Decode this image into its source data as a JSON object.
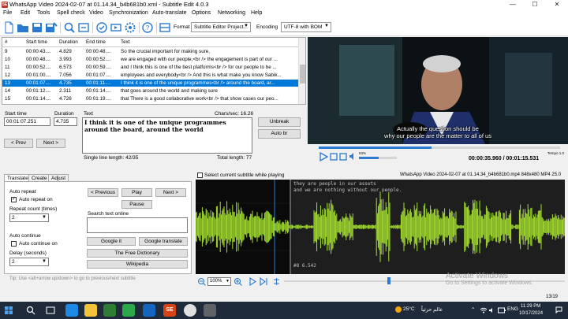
{
  "window": {
    "title": "WhatsApp Video 2024-02-07 at 01.14.34_b4b681b0.xml - Subtitle Edit 4.0.3",
    "app_icon": "subtitle-edit-icon"
  },
  "menu": [
    "File",
    "Edit",
    "Tools",
    "Spell check",
    "Video",
    "Synchronization",
    "Auto-translate",
    "Options",
    "Networking",
    "Help"
  ],
  "toolbar": {
    "format_label": "Format",
    "format_value": "Subtitle Editor Project...",
    "encoding_label": "Encoding",
    "encoding_value": "UTF-8 with BOM"
  },
  "grid": {
    "columns": [
      "#",
      "Start time",
      "Duration",
      "End time",
      "Text"
    ],
    "rows": [
      {
        "num": "9",
        "start": "00:00:43....",
        "duration": "4.829",
        "end": "00:00:48....",
        "text": "So the crucial important for making sure,"
      },
      {
        "num": "10",
        "start": "00:00:48....",
        "duration": "3.993",
        "end": "00:00:52....",
        "text": "we are engaged with our people,<br /> the engagement is part of our ..."
      },
      {
        "num": "11",
        "start": "00:00:52....",
        "duration": "6.573",
        "end": "00:00:59....",
        "text": "and I think this is one of the best platforms<br /> for our people to be ..."
      },
      {
        "num": "12",
        "start": "00:01:00....",
        "duration": "7.056",
        "end": "00:01:07....",
        "text": "employees and everybody<br /> And this is what make you know Sabik..."
      },
      {
        "num": "13",
        "start": "00:01:07....",
        "duration": "4.735",
        "end": "00:01:11....",
        "text": "I think it is one of the unique programmes<br /> around the board, ar..."
      },
      {
        "num": "14",
        "start": "00:01:12....",
        "duration": "2.311",
        "end": "00:01:14....",
        "text": "that goes around the world and making sure"
      },
      {
        "num": "15",
        "start": "00:01:14....",
        "duration": "4.726",
        "end": "00:01:19....",
        "text": "that There is a good collaborative work<br /> that show cases our peo..."
      }
    ],
    "selected_index": 4
  },
  "editor": {
    "start_time_label": "Start time",
    "start_time_value": "00:01:07.251",
    "duration_label": "Duration",
    "duration_value": "4.735",
    "text_label": "Text",
    "chars_sec": "Chars/sec: 16.26",
    "text_line1": "I think it is one of the unique programmes",
    "text_line2": "around the board, around the world",
    "single_line_length": "Single line length: 42/35",
    "total_length": "Total length: 77",
    "unbreak_label": "Unbreak",
    "auto_br_label": "Auto br",
    "prev_label": "< Prev",
    "next_label": "Next >"
  },
  "video": {
    "subtitle_line1": "Actually the question should be",
    "subtitle_line2": "why our people are the matter to all of us",
    "volume_pct": "53%",
    "speed": "Tempo 1.0",
    "time_current": "00:00:35.960",
    "time_total": "00:01:15.531",
    "time_separator": " / "
  },
  "tabs": [
    "Translate",
    "Create",
    "Adjust"
  ],
  "translate": {
    "auto_repeat_label": "Auto repeat",
    "auto_repeat_on_label": "Auto repeat on",
    "repeat_count_label": "Repeat count (times)",
    "repeat_count_value": "2",
    "auto_continue_label": "Auto continue",
    "auto_continue_on_label": "Auto continue on",
    "delay_label": "Delay (seconds)",
    "delay_value": "2",
    "previous_label": "< Previous",
    "play_label": "Play",
    "next_label": "Next >",
    "pause_label": "Pause",
    "search_label": "Search text online",
    "google_it_label": "Google it",
    "google_translate_label": "Google translate",
    "free_dictionary_label": "The Free Dictionary",
    "wikipedia_label": "Wikipedia",
    "tip": "Tip: Use <alt+arrow up/down> to go to previous/next subtitle"
  },
  "waveform": {
    "select_current_label": "Select current subtitle while playing",
    "file_info": "WhatsApp Video 2024-02-07 at 01.14.34_b4b681b0.mp4 848x480 MP4 25.0",
    "segment_line1": "they are people in our assets",
    "segment_line2": "and we are nothing without our people.",
    "segment_marker": "#8  6.542",
    "zoom_value": "100%",
    "page_count": "13/19",
    "watermark_line1": "Activate Windows",
    "watermark_line2": "Go to Settings to activate Windows."
  },
  "taskbar": {
    "weather": "25°C",
    "weather_desc": "عالم حزئياً",
    "language": "ENG",
    "time": "11:29 PM",
    "date": "10/17/2024"
  },
  "colors": {
    "selection": "#0078d7",
    "waveform": "#a6e22e",
    "subtitle_text": "#ffffff"
  }
}
